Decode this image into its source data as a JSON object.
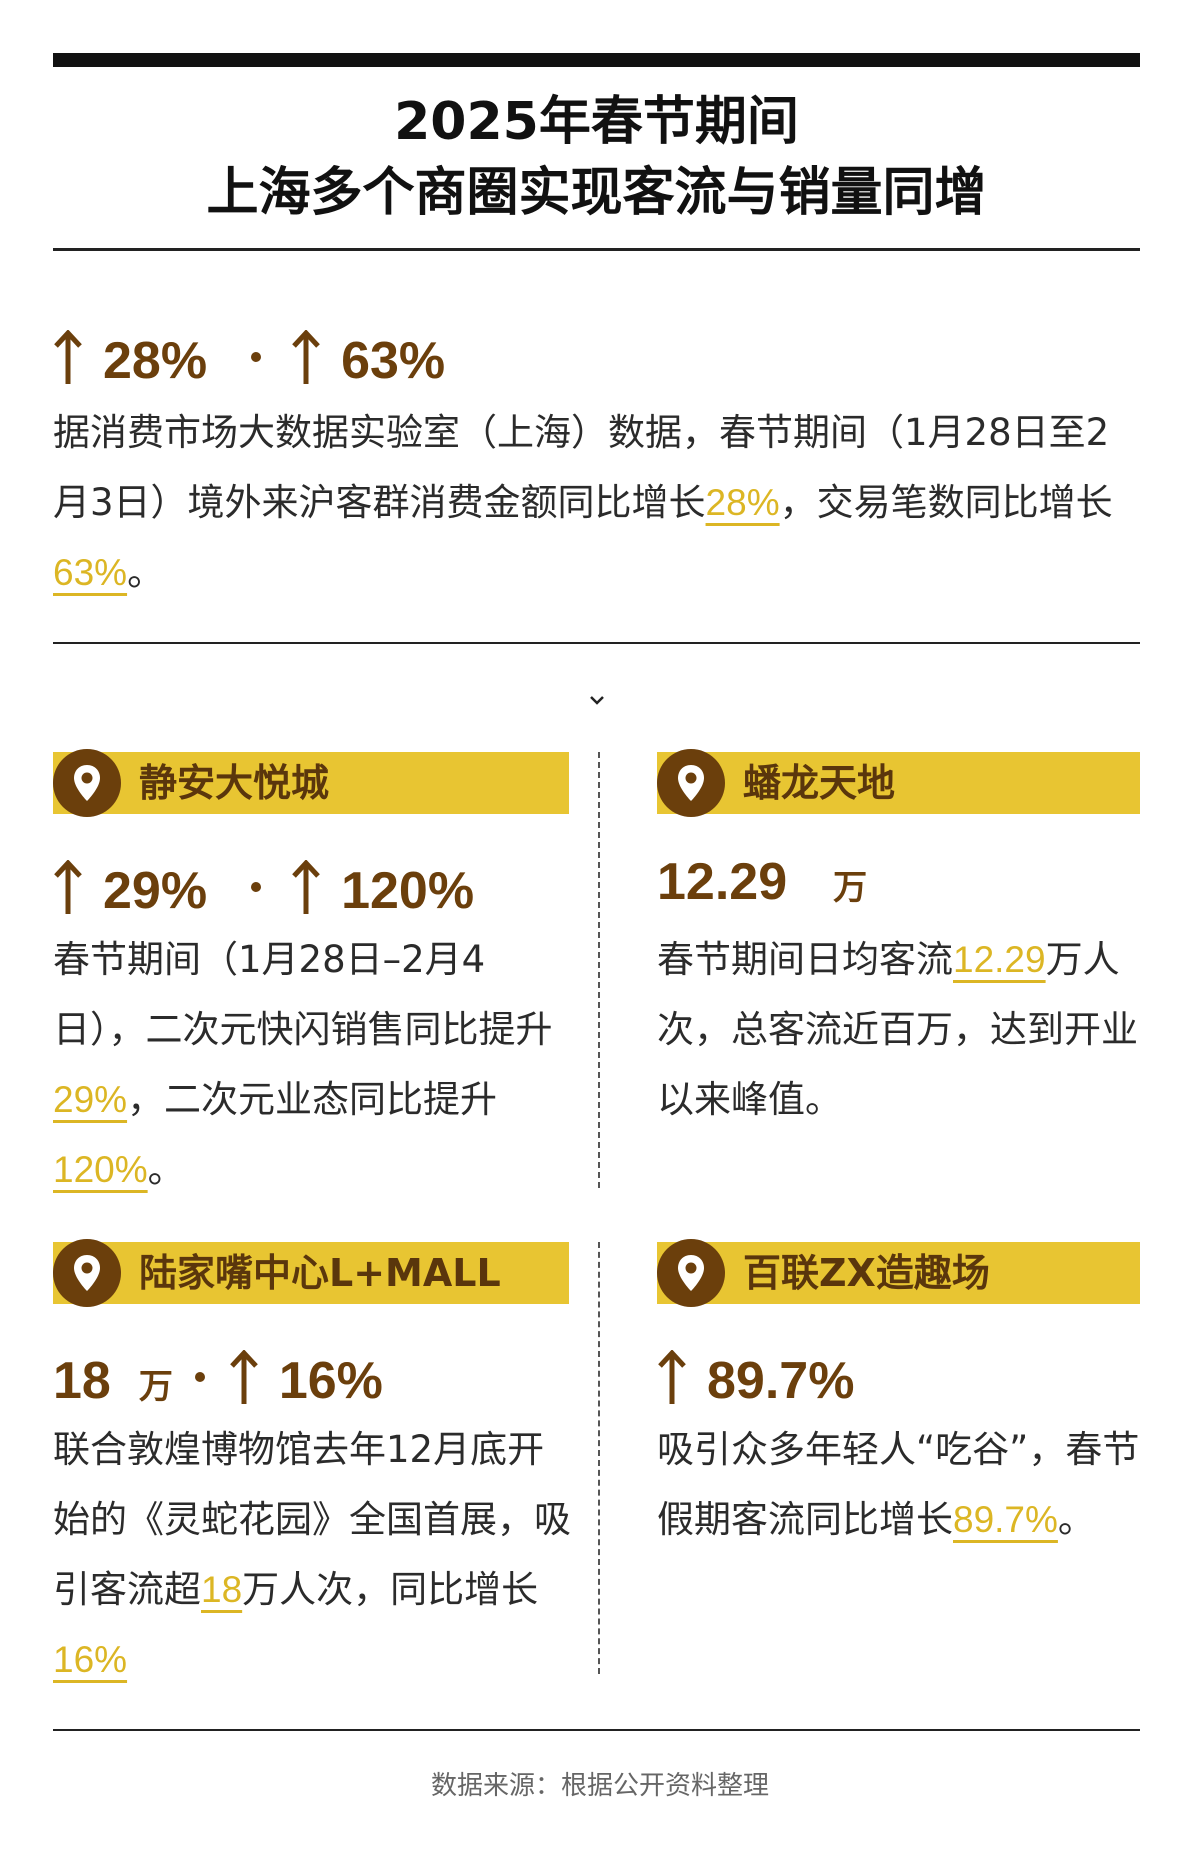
{
  "title": {
    "line1": "2025年春节期间",
    "line2": "上海多个商圈实现客流与销量同增"
  },
  "intro": {
    "stat1": "28%",
    "stat2": "63%",
    "text_a": "据消费市场大数据实验室（上海）数据，春节期间（1月28日至2月3日）境外来沪客群消费金额同比增长",
    "hl1": "28%",
    "text_b": "，交易笔数同比增长",
    "hl2": "63%",
    "text_c": "。"
  },
  "cards": {
    "jingan": {
      "name": "静安大悦城",
      "stat1": "29%",
      "stat2": "120%",
      "text_a": "春节期间（1月28日–2月4日），二次元快闪销售同比提升",
      "hl1": "29%",
      "text_b": "，二次元业态同比提升",
      "hl2": "120%",
      "text_c": "。"
    },
    "panlong": {
      "name": "蟠龙天地",
      "stat_value": "12.29",
      "stat_unit": "万",
      "text_a": "春节期间日均客流",
      "hl1": "12.29",
      "text_b": "万人次，总客流近百万，达到开业以来峰值。"
    },
    "lujiazui": {
      "name": "陆家嘴中心L+MALL",
      "stat_value": "18",
      "stat_unit": "万",
      "stat2": "16%",
      "text_a": "联合敦煌博物馆去年12月底开始的《灵蛇花园》全国首展，吸引客流超",
      "hl1": "18",
      "text_b": "万人次，同比增长",
      "hl2": "16%"
    },
    "bailian": {
      "name": "百联ZX造趣场",
      "stat1": "89.7%",
      "text_a": "吸引众多年轻人“吃谷”，春节假期客流同比增长",
      "hl1": "89.7%",
      "text_b": "。"
    }
  },
  "source": "数据来源：根据公开资料整理",
  "colors": {
    "brown": "#6b3f0c",
    "gold": "#e8c532",
    "highlight": "#dcb624",
    "black": "#111111"
  },
  "icons": [
    "arrow-up-icon",
    "location-pin-icon",
    "chevron-down-icon"
  ]
}
